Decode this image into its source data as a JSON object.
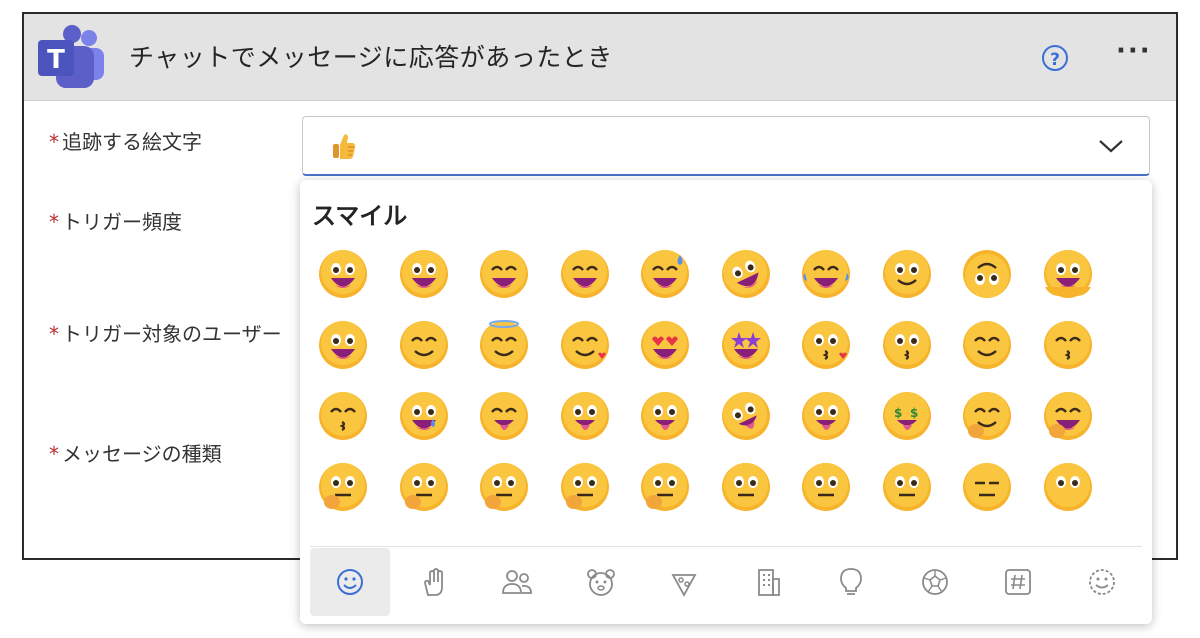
{
  "header": {
    "title": "チャットでメッセージに応答があったとき",
    "help_label": "?",
    "more_label": "···"
  },
  "fields": [
    {
      "label": "追跡する絵文字",
      "required": "*"
    },
    {
      "label": "トリガー頻度",
      "required": "*"
    },
    {
      "label": "トリガー対象のユーザー",
      "required": "*"
    },
    {
      "label": "メッセージの種類",
      "required": "*"
    }
  ],
  "select": {
    "value_icon": "thumbs-up-emoji"
  },
  "picker": {
    "category_title": "スマイル",
    "emoji_rows": [
      [
        "grinning-face",
        "grinning-big-eyes",
        "grinning-smiling-eyes",
        "beaming-face",
        "grinning-sweat",
        "rolling-on-floor-laughing",
        "tears-of-joy",
        "slightly-smiling",
        "upside-down-face",
        "melting-face"
      ],
      [
        "winking-face",
        "smiling-eyes",
        "halo-face",
        "smiling-hearts",
        "heart-eyes",
        "star-struck",
        "kissing-heart",
        "kissing-face",
        "smiling-face",
        "kissing-smiling-eyes"
      ],
      [
        "kissing-closed-eyes",
        "face-holding-back-tears",
        "savoring-food",
        "face-with-tongue",
        "winking-tongue",
        "zany-face",
        "squinting-tongue",
        "money-mouth",
        "hugging-face",
        "hand-over-mouth"
      ],
      [
        "open-eyes-hand-over-mouth",
        "peeking-eye",
        "shushing-face",
        "thinking-face",
        "saluting-face",
        "zipper-mouth",
        "raised-eyebrow",
        "neutral-face",
        "expressionless",
        "no-mouth"
      ]
    ],
    "tabs": [
      "smiley-icon",
      "hand-icon",
      "people-icon",
      "animal-icon",
      "food-icon",
      "building-icon",
      "lightbulb-icon",
      "ball-icon",
      "symbol-icon",
      "custom-emoji-icon"
    ],
    "active_tab": "smiley-icon"
  },
  "colors": {
    "header_bg": "#e3e3e3",
    "accent": "#4a72c8",
    "required": "#b03030",
    "emoji_face": "#f7b32b",
    "teams_purple": "#5b5fc7"
  }
}
